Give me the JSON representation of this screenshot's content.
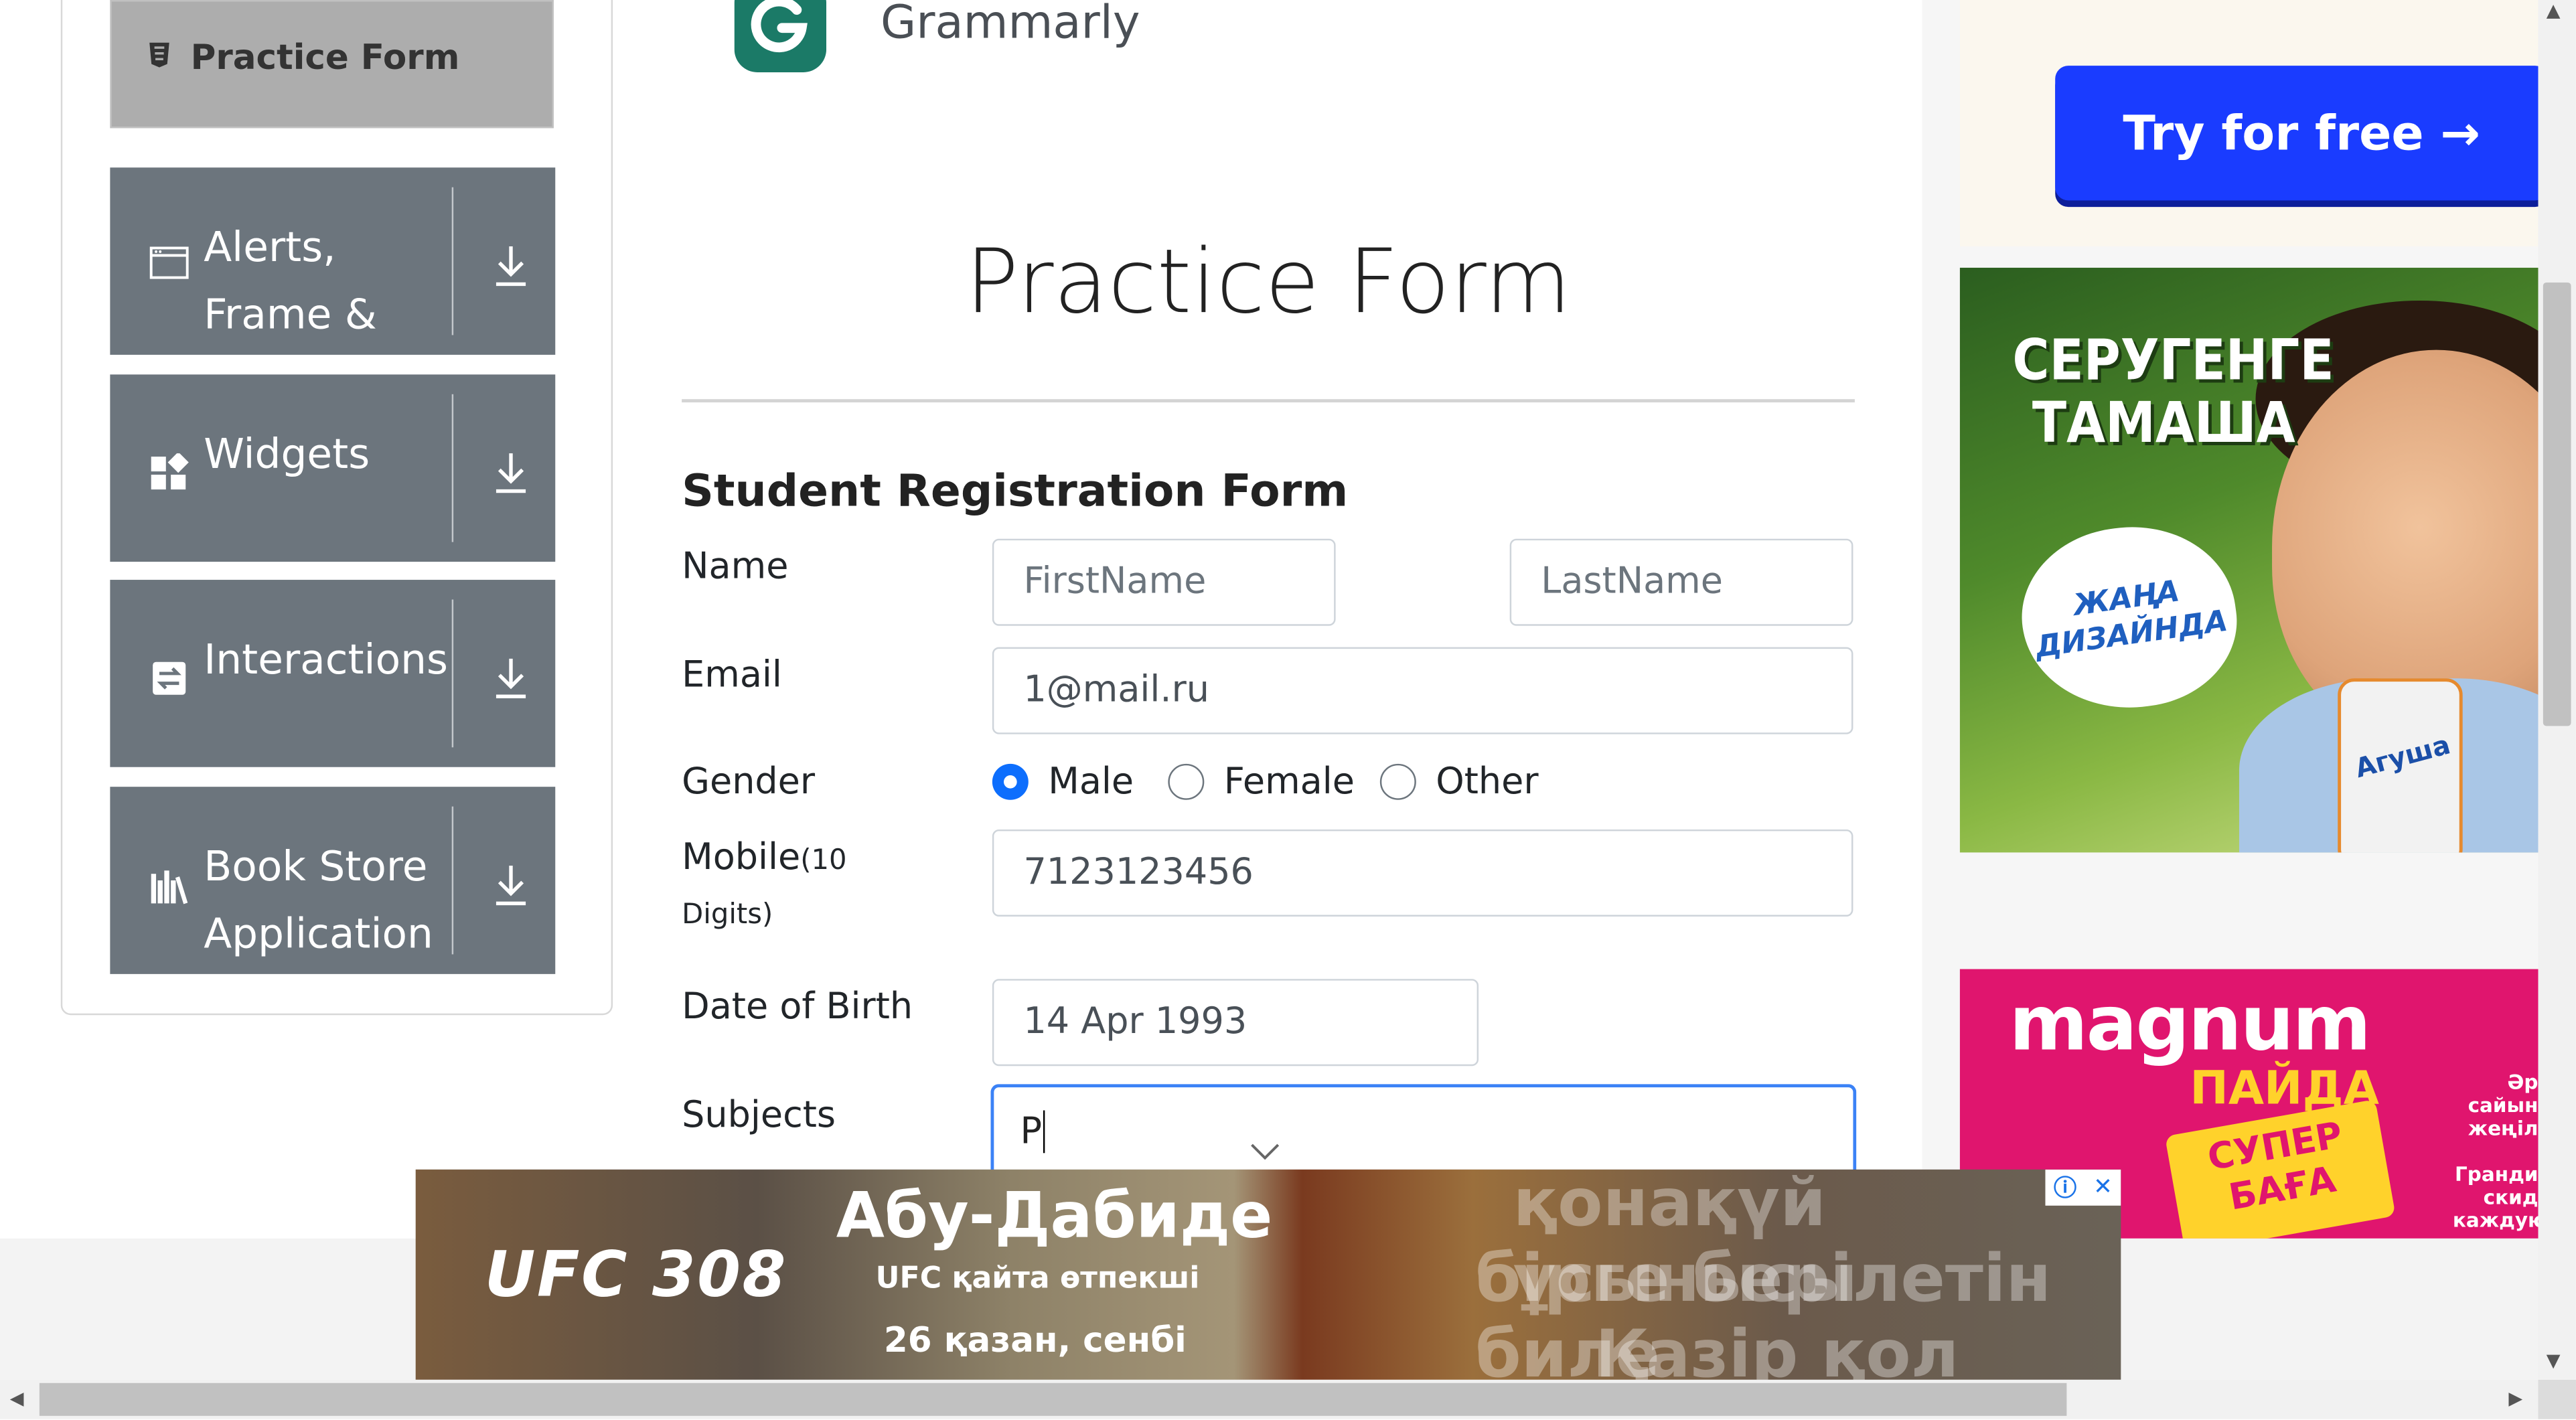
{
  "sidebar": {
    "practice_form": "Practice Form",
    "items": [
      {
        "label": "Alerts, Frame & Windows",
        "icon": "window-icon"
      },
      {
        "label": "Widgets",
        "icon": "widgets-icon"
      },
      {
        "label": "Interactions",
        "icon": "interactions-icon"
      },
      {
        "label": "Book Store Application",
        "icon": "book-icon"
      }
    ]
  },
  "header": {
    "brand": "Grammarly"
  },
  "form": {
    "page_title": "Practice Form",
    "section_title": "Student Registration Form",
    "name_label": "Name",
    "first_name_placeholder": "FirstName",
    "last_name_placeholder": "LastName",
    "email_label": "Email",
    "email_value": "1@mail.ru",
    "gender_label": "Gender",
    "gender_options": [
      "Male",
      "Female",
      "Other"
    ],
    "gender_selected": "Male",
    "mobile_label": "Mobile",
    "mobile_hint": "(10 Digits)",
    "mobile_hint_1": "(10",
    "mobile_hint_2": "Digits)",
    "mobile_value": "7123123456",
    "dob_label": "Date of Birth",
    "dob_value": "14 Apr 1993",
    "subjects_label": "Subjects",
    "subjects_value": "P"
  },
  "ads": {
    "grammarly_cta": "Try for free →",
    "ad1_headline": "СЕРУГЕНГЕ ТАМАША",
    "ad1_line1": "СЕРУГЕНГЕ",
    "ad1_line2": "ТАМАША",
    "ad1_badge": "ЖАҢА ДИЗАЙНДА",
    "ad1_product": "Агуша",
    "ad2_brand": "magnum",
    "ad2_sub": "ПАЙДА",
    "ad2_tag": "СУПЕР БАҒА",
    "ad2_side1": "Әр сайын жеңіл",
    "ad2_side2": "Гранди скид каждую",
    "ufc_logo": "UFC 308",
    "ufc_headline": "Абу-Дабиде",
    "ufc_sub": "UFC қайта өтпекші",
    "ufc_date": "26 қазан, сенбі",
    "ufc_ghost1": "қонақүй ұсынысы",
    "ufc_ghost2": "бірге берілетін биле",
    "ufc_ghost3": "Қазір қол жетімд"
  }
}
